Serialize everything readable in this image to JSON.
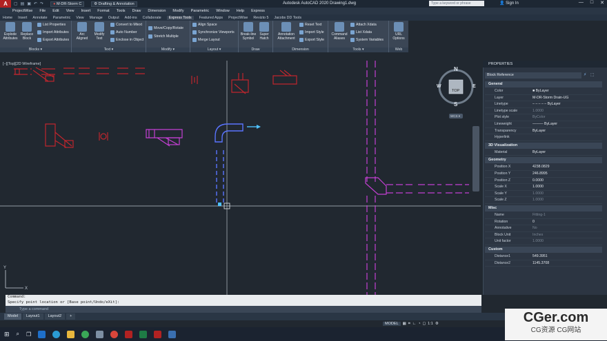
{
  "titlebar": {
    "app_logo": "A",
    "workspace_layer": "M-DR-Storm C",
    "workspace": "Drafting & Annotation",
    "window_title": "Autodesk AutoCAD 2020   Drawing1.dwg",
    "search_placeholder": "Type a keyword or phrase",
    "signin": "Sign In",
    "controls": [
      "—",
      "□",
      "✕"
    ]
  },
  "menubar": [
    "ProjectWise",
    "File",
    "Edit",
    "View",
    "Insert",
    "Format",
    "Tools",
    "Draw",
    "Dimension",
    "Modify",
    "Parametric",
    "Window",
    "Help",
    "Express"
  ],
  "ribbon_tabs": [
    "Home",
    "Insert",
    "Annotate",
    "Parametric",
    "View",
    "Manage",
    "Output",
    "Add-ins",
    "Collaborate",
    "Express Tools",
    "Featured Apps",
    "ProjectWise",
    "Revizto 5",
    "Jacobs DD Tools"
  ],
  "ribbon_active_tab": "Express Tools",
  "ribbon": {
    "blocks": {
      "label": "Blocks ▾",
      "explode": "Explode\nAttributes",
      "replace": "Replace\nBlock",
      "list_properties": "List Properties",
      "import_attributes": "Import Attributes",
      "export_attributes": "Export Attributes"
    },
    "text": {
      "label": "Text ▾",
      "arc_aligned": "Arc\nAligned",
      "modify_text": "Modify\nText",
      "convert_mtext": "Convert to Mtext",
      "auto_number": "Auto Number",
      "enclose": "Enclose in Object"
    },
    "modify": {
      "label": "Modify ▾",
      "move_copy_rotate": "Move/Copy/Rotate",
      "stretch_multiple": "Stretch Multiple"
    },
    "layout": {
      "label": "Layout ▾",
      "align_space": "Align Space",
      "sync_viewports": "Synchronize Viewports",
      "merge_layout": "Merge Layout"
    },
    "draw": {
      "label": "Draw",
      "break_line": "Break-line\nSymbol",
      "super_hatch": "Super\nHatch"
    },
    "dimension": {
      "label": "Dimension",
      "annotation_attachment": "Annotation\nAttachment",
      "reset_text": "Reset Text",
      "import_style": "Import Style",
      "export_style": "Export Style"
    },
    "tools": {
      "label": "Tools ▾",
      "command_aliases": "Command\nAliases",
      "attach_xdata": "Attach Xdata",
      "list_xdata": "List Xdata",
      "system_variables": "System Variables"
    },
    "web": {
      "label": "Web",
      "url_options": "URL\nOptions"
    }
  },
  "viewport_label": "[−][Top][2D Wireframe]",
  "viewcube": {
    "face": "TOP",
    "n": "N",
    "s": "S",
    "e": "E",
    "w": "W",
    "wcs": "WCS ▾"
  },
  "properties": {
    "title": "PROPERTIES",
    "selection": "Block Reference",
    "sections": [
      {
        "name": "General",
        "rows": [
          {
            "k": "Color",
            "v": "■ ByLayer"
          },
          {
            "k": "Layer",
            "v": "M-DR-Storm Drain-UG"
          },
          {
            "k": "Linetype",
            "v": "– – – – – ByLayer"
          },
          {
            "k": "Linetype scale",
            "v": "1.0000",
            "dim": true
          },
          {
            "k": "Plot style",
            "v": "ByColor",
            "dim": true
          },
          {
            "k": "Lineweight",
            "v": "——— ByLayer"
          },
          {
            "k": "Transparency",
            "v": "ByLayer"
          },
          {
            "k": "Hyperlink",
            "v": ""
          }
        ]
      },
      {
        "name": "3D Visualization",
        "rows": [
          {
            "k": "Material",
            "v": "ByLayer"
          }
        ]
      },
      {
        "name": "Geometry",
        "rows": [
          {
            "k": "Position X",
            "v": "4238.0829"
          },
          {
            "k": "Position Y",
            "v": "246.8995"
          },
          {
            "k": "Position Z",
            "v": "0.0000"
          },
          {
            "k": "Scale X",
            "v": "1.0000"
          },
          {
            "k": "Scale Y",
            "v": "1.0000",
            "dim": true
          },
          {
            "k": "Scale Z",
            "v": "1.0000",
            "dim": true
          }
        ]
      },
      {
        "name": "Misc",
        "rows": [
          {
            "k": "Name",
            "v": "Fitting-1",
            "dim": true
          },
          {
            "k": "Rotation",
            "v": "0"
          },
          {
            "k": "Annotative",
            "v": "No",
            "dim": true
          },
          {
            "k": "Block Unit",
            "v": "Inches",
            "dim": true
          },
          {
            "k": "Unit factor",
            "v": "1.0000",
            "dim": true
          }
        ]
      },
      {
        "name": "Custom",
        "rows": [
          {
            "k": "Distance1",
            "v": "549.3951"
          },
          {
            "k": "Distance2",
            "v": "1145.3708"
          }
        ]
      }
    ]
  },
  "command": {
    "history1": "Command:",
    "history2": "Specify point location or [Base point/Undo/eXit]:",
    "placeholder": "Type a command"
  },
  "layout_tabs": [
    "Model",
    "Layout1",
    "Layout2",
    "+"
  ],
  "status": {
    "model": "MODEL",
    "scale": "1:1"
  },
  "watermark": {
    "main": "CGer.com",
    "sub": "CG资源 CG网站"
  },
  "colors": {
    "red": "#c0262d",
    "magenta": "#c43fd3",
    "blue": "#4a6cff",
    "cyan": "#4fc1ff"
  }
}
